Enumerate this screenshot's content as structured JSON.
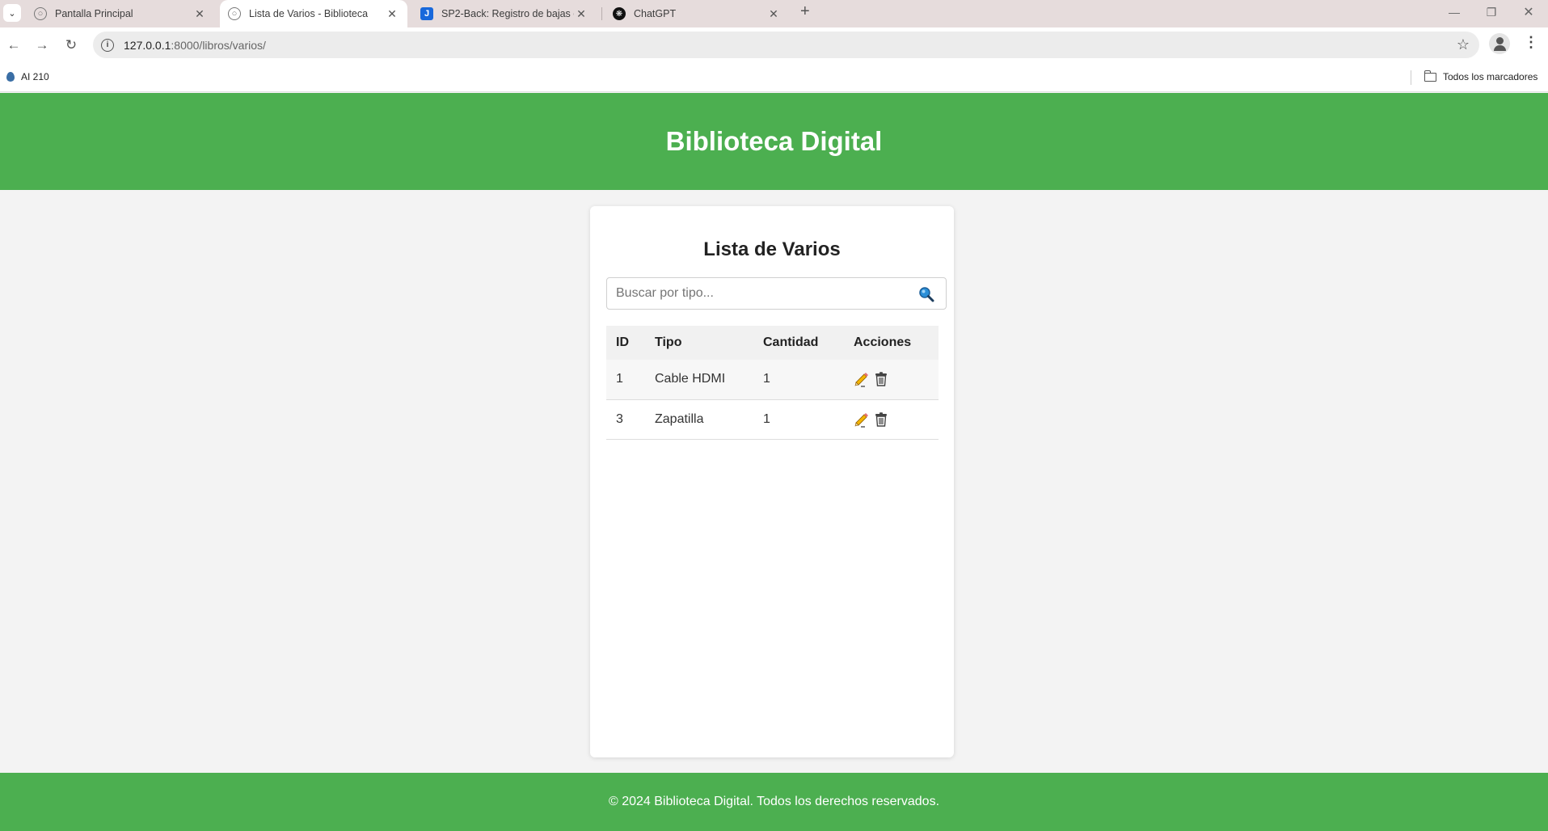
{
  "browser": {
    "tabs": [
      {
        "title": "Pantalla Principal",
        "active": false
      },
      {
        "title": "Lista de Varios - Biblioteca",
        "active": true
      },
      {
        "title": "SP2-Back: Registro de bajas en",
        "active": false
      },
      {
        "title": "ChatGPT",
        "active": false
      }
    ],
    "url_host": "127.0.0.1",
    "url_rest": ":8000/libros/varios/",
    "bookmarks": {
      "left": "AI 210",
      "right": "Todos los marcadores"
    }
  },
  "header": {
    "title": "Biblioteca Digital"
  },
  "main": {
    "title": "Lista de Varios",
    "search": {
      "placeholder": "Buscar por tipo...",
      "value": ""
    },
    "table": {
      "headers": [
        "ID",
        "Tipo",
        "Cantidad",
        "Acciones"
      ],
      "rows": [
        {
          "id": "1",
          "tipo": "Cable HDMI",
          "cantidad": "1"
        },
        {
          "id": "3",
          "tipo": "Zapatilla",
          "cantidad": "1"
        }
      ]
    }
  },
  "footer": {
    "text": "© 2024 Biblioteca Digital. Todos los derechos reservados."
  },
  "colors": {
    "brand": "#4caf50",
    "background": "#f3f3f3",
    "card": "#ffffff"
  },
  "icons": [
    "search-icon",
    "edit-icon",
    "delete-icon"
  ]
}
